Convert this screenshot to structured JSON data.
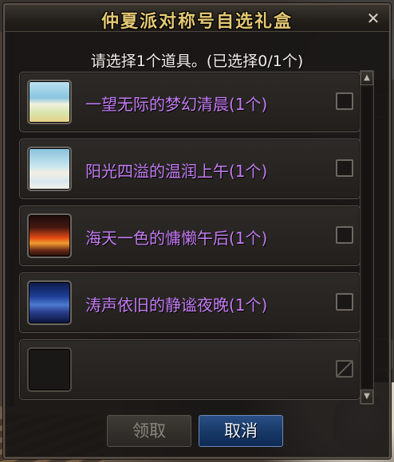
{
  "dialog": {
    "title": "仲夏派对称号自选礼盒",
    "close_symbol": "✕",
    "prompt": "请选择1个道具。(已选择0/1个)"
  },
  "items": [
    {
      "name": "一望无际的梦幻清晨",
      "qty": "(1个)",
      "thumb_icon": "morning-beach-icon",
      "checked": false
    },
    {
      "name": "阳光四溢的温润上午",
      "qty": "(1个)",
      "thumb_icon": "forenoon-beach-icon",
      "checked": false
    },
    {
      "name": "海天一色的慵懒午后",
      "qty": "(1个)",
      "thumb_icon": "sunset-sea-icon",
      "checked": false
    },
    {
      "name": "涛声依旧的静谧夜晚",
      "qty": "(1个)",
      "thumb_icon": "night-sea-icon",
      "checked": false
    },
    {
      "name": "",
      "qty": "",
      "thumb_icon": "empty-slot",
      "checked": false,
      "disabled": true
    }
  ],
  "scrollbar": {
    "up_symbol": "▲",
    "down_symbol": "▼"
  },
  "buttons": {
    "claim_label": "领取",
    "cancel_label": "取消"
  },
  "colors": {
    "title_gold": "#e4c873",
    "item_name_purple": "#c57cf4",
    "cancel_blue": "#173866",
    "dialog_bg": "#181614"
  }
}
